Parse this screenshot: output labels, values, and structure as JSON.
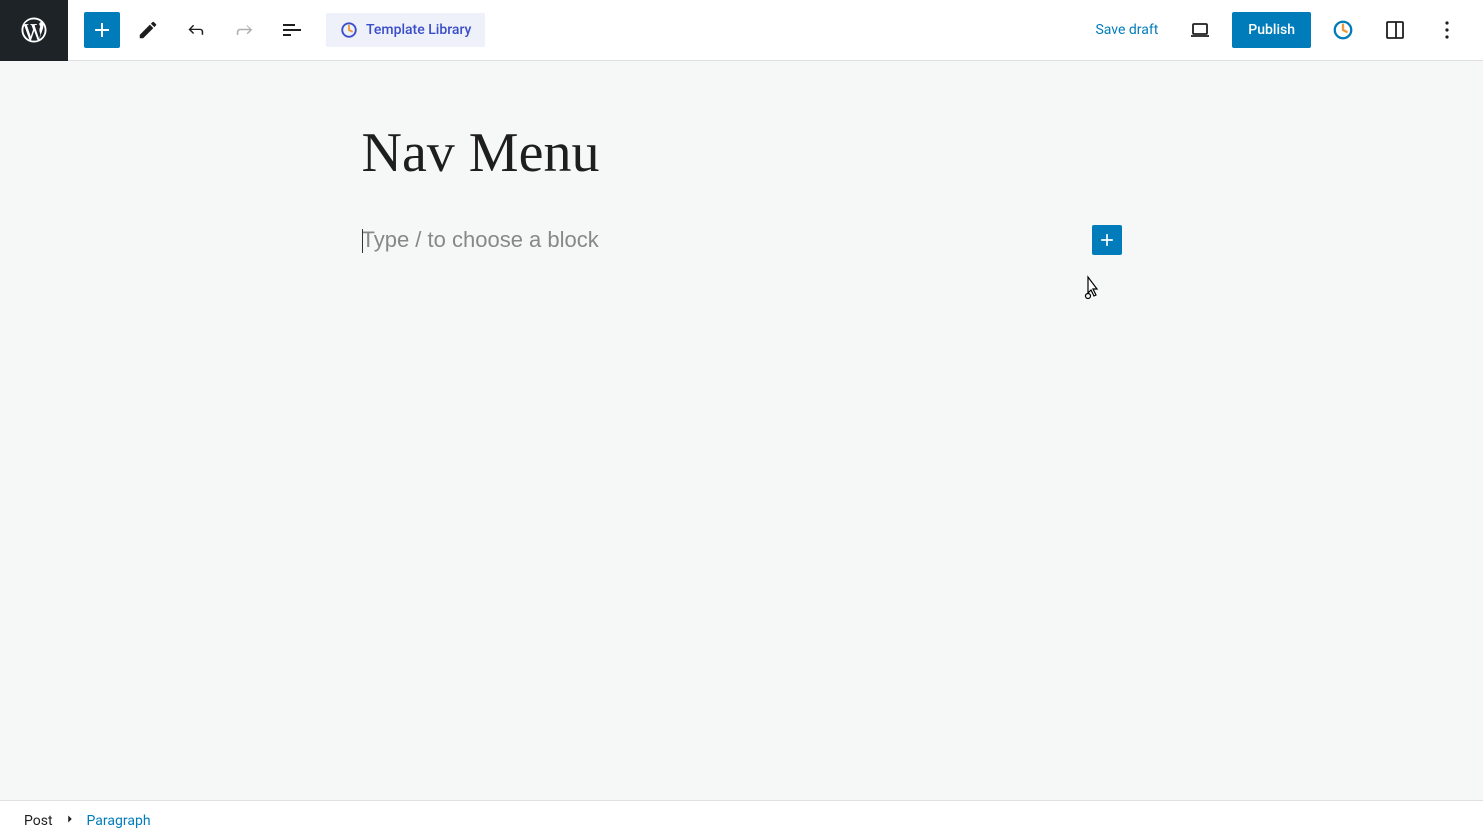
{
  "toolbar": {
    "template_library_label": "Template Library",
    "save_draft_label": "Save draft",
    "publish_label": "Publish"
  },
  "editor": {
    "post_title": "Nav Menu",
    "block_placeholder": "Type / to choose a block"
  },
  "breadcrumb": {
    "root": "Post",
    "current": "Paragraph"
  },
  "colors": {
    "accent": "#007cba",
    "wp_dark": "#1d2327",
    "template_bg": "#eef0fa",
    "template_fg": "#3a4ec8"
  }
}
